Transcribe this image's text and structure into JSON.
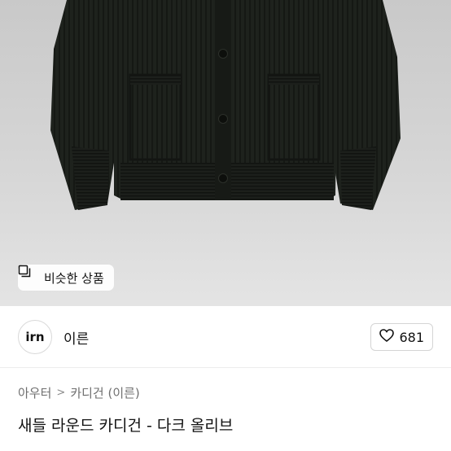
{
  "product_image": {
    "alt": "dark olive round cardigan"
  },
  "similar_button": {
    "label": "비슷한 상품",
    "icon": "similar-items-icon"
  },
  "seller": {
    "avatar_text": "irn",
    "name": "이른"
  },
  "like": {
    "icon": "heart-outline-icon",
    "count": "681"
  },
  "breadcrumb": {
    "items": [
      "아우터",
      "카디건 (이른)"
    ],
    "separator": ">"
  },
  "product": {
    "title": "새들 라운드 카디건 - 다크 올리브"
  },
  "colors": {
    "cardigan": "#1e221d",
    "background": "#d2d2d2"
  }
}
